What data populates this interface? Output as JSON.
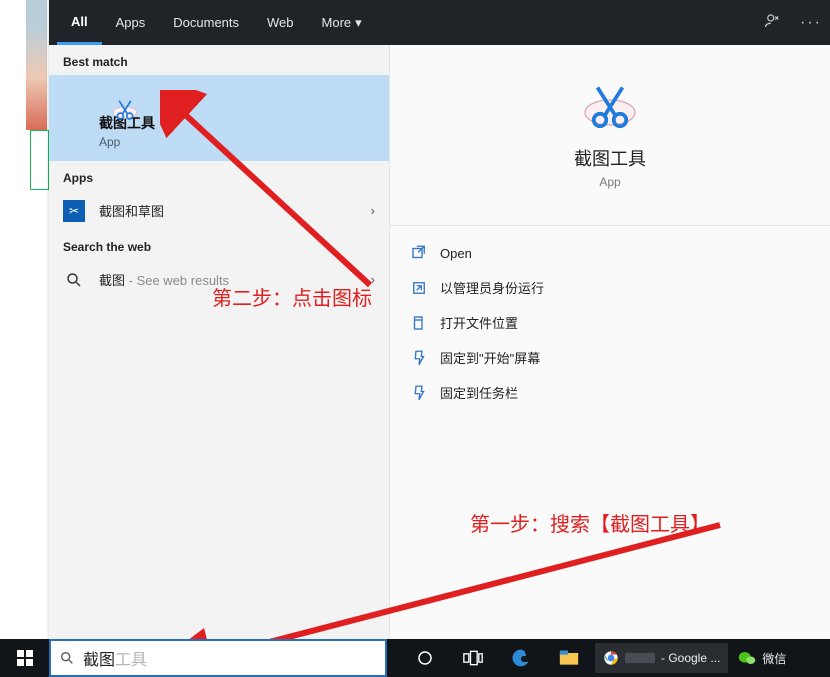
{
  "tabs": {
    "all": "All",
    "apps": "Apps",
    "documents": "Documents",
    "web": "Web",
    "more": "More"
  },
  "sections": {
    "best": "Best match",
    "apps": "Apps",
    "web": "Search the web"
  },
  "best": {
    "title": "截图工具",
    "sub": "App"
  },
  "appsList": {
    "item1": "截图和草图"
  },
  "webList": {
    "query": "截图",
    "suffix": " - See web results"
  },
  "preview": {
    "title": "截图工具",
    "sub": "App"
  },
  "actions": {
    "open": "Open",
    "runAdmin": "以管理员身份运行",
    "openLocation": "打开文件位置",
    "pinStart": "固定到\"开始\"屏幕",
    "pinTaskbar": "固定到任务栏"
  },
  "annotations": {
    "step1": "第一步：搜索【截图工具】",
    "step2": "第二步：点击图标"
  },
  "search": {
    "typed": "截图",
    "ghost": "工具"
  },
  "taskbar": {
    "chrome": " - Google ...",
    "wechat": "微信"
  }
}
